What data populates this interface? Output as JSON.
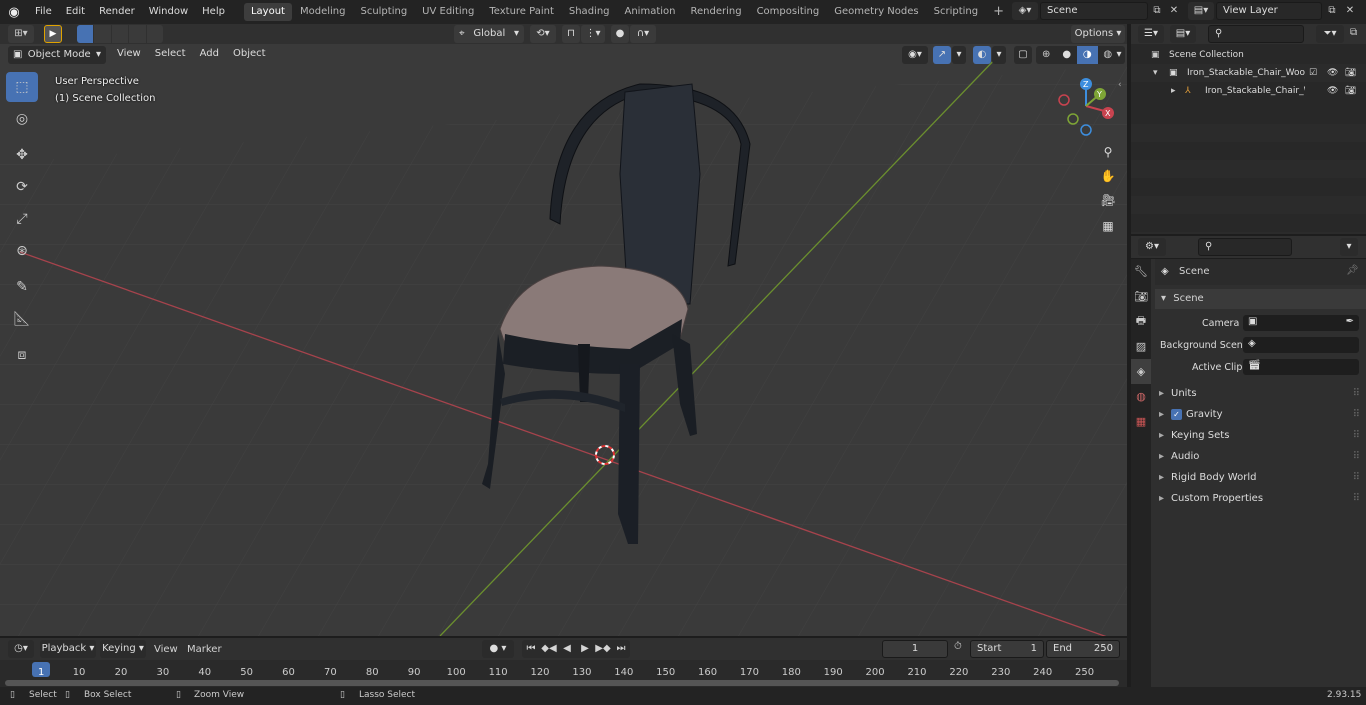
{
  "topbar": {
    "menus": [
      "File",
      "Edit",
      "Render",
      "Window",
      "Help"
    ],
    "workspaces": [
      "Layout",
      "Modeling",
      "Sculpting",
      "UV Editing",
      "Texture Paint",
      "Shading",
      "Animation",
      "Rendering",
      "Compositing",
      "Geometry Nodes",
      "Scripting"
    ],
    "active_workspace": "Layout",
    "scene_name": "Scene",
    "view_layer_name": "View Layer"
  },
  "viewport_header": {
    "mode": "Object Mode",
    "menus": [
      "View",
      "Select",
      "Add",
      "Object"
    ],
    "transform_orientation": "Global",
    "options_label": "Options"
  },
  "viewport": {
    "overlay_line1": "User Perspective",
    "overlay_line2": "(1) Scene Collection",
    "gizmo_axes": {
      "x": "X",
      "y": "Y",
      "z": "Z"
    }
  },
  "outliner": {
    "root": "Scene Collection",
    "items": [
      {
        "label": "Iron_Stackable_Chair_Wooden"
      },
      {
        "label": "Iron_Stackable_Chair_Wc"
      }
    ]
  },
  "properties": {
    "context_title": "Scene",
    "section_title": "Scene",
    "fields": [
      {
        "label": "Camera"
      },
      {
        "label": "Background Scene"
      },
      {
        "label": "Active Clip"
      }
    ],
    "panels": [
      "Units",
      "Gravity",
      "Keying Sets",
      "Audio",
      "Rigid Body World",
      "Custom Properties"
    ]
  },
  "timeline": {
    "menus": [
      "Playback",
      "Keying",
      "View",
      "Marker"
    ],
    "current_frame": "1",
    "start_label": "Start",
    "start_value": "1",
    "end_label": "End",
    "end_value": "250",
    "ruler": [
      "1",
      "10",
      "20",
      "30",
      "40",
      "50",
      "60",
      "70",
      "80",
      "90",
      "100",
      "110",
      "120",
      "130",
      "140",
      "150",
      "160",
      "170",
      "180",
      "190",
      "200",
      "210",
      "220",
      "230",
      "240",
      "250"
    ]
  },
  "statusbar": {
    "select": "Select",
    "box_select": "Box Select",
    "zoom_view": "Zoom View",
    "lasso_select": "Lasso Select",
    "version": "2.93.15"
  },
  "colors": {
    "accent": "#4772b3",
    "x_axis": "#c8434f",
    "y_axis": "#7ea536",
    "z_axis": "#3d8ede"
  }
}
